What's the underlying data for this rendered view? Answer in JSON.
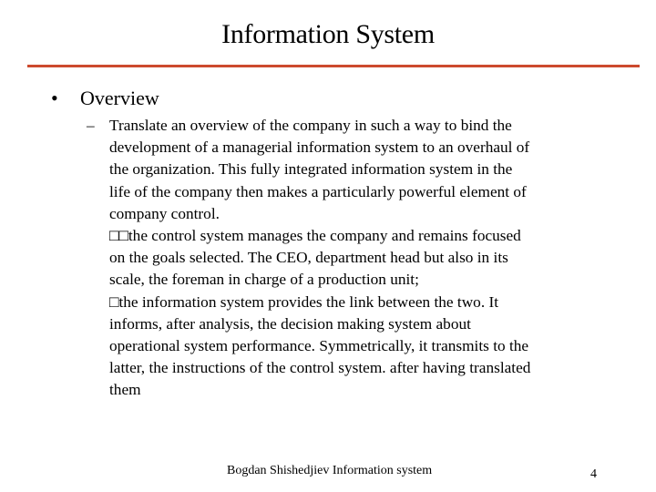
{
  "slide": {
    "title": "Information System",
    "accent_color": "#cc4a2e",
    "bullets": [
      {
        "icon": "bullet-dot-icon",
        "glyph": "•",
        "label": "Overview",
        "sub_items": [
          {
            "icon": "dash-icon",
            "glyph": "–",
            "text": "Translate an overview of the company in such a way to bind the\ndevelopment of a managerial information system to an overhaul of\nthe organization. This fully integrated information system in the\nlife of the company then makes a particularly powerful element of\ncompany control.\n□□the control system manages the company and remains focused\non the goals selected. The CEO, department head but also in its\nscale, the foreman in charge of a production unit;\n□the information system provides the link between the two. It\ninforms, after analysis, the decision making system about\noperational system performance. Symmetrically, it transmits to the\nlatter, the instructions of the control system. after having translated\nthem"
          }
        ]
      }
    ]
  },
  "footer": {
    "text": "Bogdan Shishedjiev Information system",
    "page_number": "4"
  }
}
